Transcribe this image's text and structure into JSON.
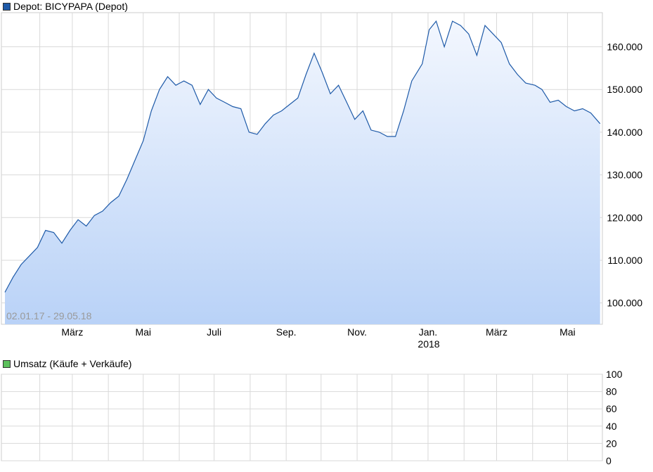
{
  "price_chart": {
    "legend": "Depot: BICYPAPA (Depot)",
    "date_range_label": "02.01.17 - 29.05.18",
    "line_color": "#1e5aa8",
    "fill_top_color": "#f3f7fe",
    "fill_bottom_color": "#b9d2f7",
    "grid_color": "#d9d9d9"
  },
  "volume_chart": {
    "legend": "Umsatz (Käufe + Verkäufe)",
    "legend_color": "#5cc05c"
  },
  "chart_data": [
    {
      "type": "area",
      "series": [
        {
          "name": "Depot: BICYPAPA (Depot)",
          "x": [
            "2017-01-02",
            "2017-01-09",
            "2017-01-16",
            "2017-01-23",
            "2017-01-30",
            "2017-02-06",
            "2017-02-13",
            "2017-02-20",
            "2017-02-27",
            "2017-03-06",
            "2017-03-13",
            "2017-03-20",
            "2017-03-27",
            "2017-04-03",
            "2017-04-10",
            "2017-04-17",
            "2017-04-24",
            "2017-05-01",
            "2017-05-08",
            "2017-05-15",
            "2017-05-22",
            "2017-05-29",
            "2017-06-05",
            "2017-06-12",
            "2017-06-19",
            "2017-06-26",
            "2017-07-03",
            "2017-07-10",
            "2017-07-17",
            "2017-07-24",
            "2017-07-31",
            "2017-08-07",
            "2017-08-14",
            "2017-08-21",
            "2017-08-28",
            "2017-09-04",
            "2017-09-11",
            "2017-09-18",
            "2017-09-25",
            "2017-10-02",
            "2017-10-09",
            "2017-10-16",
            "2017-10-23",
            "2017-10-30",
            "2017-11-06",
            "2017-11-13",
            "2017-11-20",
            "2017-11-27",
            "2017-12-04",
            "2017-12-11",
            "2017-12-18",
            "2017-12-27",
            "2018-01-02",
            "2018-01-08",
            "2018-01-15",
            "2018-01-22",
            "2018-01-29",
            "2018-02-05",
            "2018-02-12",
            "2018-02-19",
            "2018-02-26",
            "2018-03-05",
            "2018-03-12",
            "2018-03-19",
            "2018-03-26",
            "2018-04-03",
            "2018-04-09",
            "2018-04-16",
            "2018-04-23",
            "2018-04-30",
            "2018-05-07",
            "2018-05-14",
            "2018-05-21",
            "2018-05-29"
          ],
          "values": [
            102.5,
            106,
            109,
            111,
            113,
            117,
            116.5,
            114,
            117,
            119.5,
            118,
            120.5,
            121.5,
            123.5,
            125,
            129,
            133.5,
            138,
            145,
            150,
            153,
            151,
            152,
            151,
            146.5,
            150,
            148,
            147,
            146,
            145.5,
            140,
            139.5,
            142,
            144,
            145,
            146.5,
            148,
            153.5,
            158.5,
            154,
            149,
            151,
            147,
            143,
            145,
            140.5,
            140,
            139,
            139,
            145,
            152,
            156,
            164,
            166,
            160,
            166,
            165,
            163,
            158,
            165,
            163,
            161,
            156,
            153.5,
            151.5,
            151,
            150,
            147,
            147.5,
            146,
            145,
            145.5,
            144.5,
            142
          ]
        }
      ],
      "xlabel": "",
      "ylabel": "",
      "ylim": [
        95,
        168
      ],
      "y_ticks": [
        "160.000",
        "150.000",
        "140.000",
        "130.000",
        "120.000",
        "110.000",
        "100.000"
      ],
      "y_tick_values": [
        160,
        150,
        140,
        130,
        120,
        110,
        100
      ],
      "x_ticks": [
        "März",
        "Mai",
        "Juli",
        "Sep.",
        "Nov.",
        "Jan.",
        "März",
        "Mai"
      ],
      "x_tick_dates": [
        "2017-03-01",
        "2017-05-01",
        "2017-07-01",
        "2017-09-01",
        "2017-11-01",
        "2018-01-01",
        "2018-03-01",
        "2018-05-01"
      ],
      "x_year_label": "2018",
      "grid": true,
      "legend_position": "top-left"
    },
    {
      "type": "bar",
      "series": [
        {
          "name": "Umsatz (Käufe + Verkäufe)",
          "values": []
        }
      ],
      "y_ticks": [
        "100",
        "80",
        "60",
        "40",
        "20",
        "0"
      ],
      "y_tick_values": [
        100,
        80,
        60,
        40,
        20,
        0
      ],
      "ylim": [
        0,
        100
      ],
      "grid": true,
      "legend_position": "top-left"
    }
  ]
}
